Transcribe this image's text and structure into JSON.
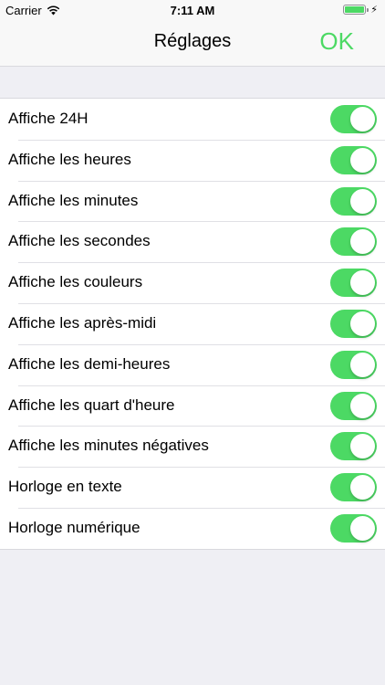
{
  "status_bar": {
    "carrier": "Carrier",
    "time": "7:11 AM",
    "battery_color": "#4cd964"
  },
  "nav": {
    "title": "Réglages",
    "ok_label": "OK",
    "ok_color": "#4cd964"
  },
  "settings": {
    "items": [
      {
        "label": "Affiche 24H",
        "on": true
      },
      {
        "label": "Affiche les heures",
        "on": true
      },
      {
        "label": "Affiche les minutes",
        "on": true
      },
      {
        "label": "Affiche les secondes",
        "on": true
      },
      {
        "label": "Affiche les couleurs",
        "on": true
      },
      {
        "label": "Affiche les après-midi",
        "on": true
      },
      {
        "label": "Affiche les demi-heures",
        "on": true
      },
      {
        "label": "Affiche les quart d'heure",
        "on": true
      },
      {
        "label": "Affiche les minutes négatives",
        "on": true
      },
      {
        "label": "Horloge en texte",
        "on": true
      },
      {
        "label": "Horloge numérique",
        "on": true
      }
    ],
    "toggle_on_color": "#4cd964"
  }
}
